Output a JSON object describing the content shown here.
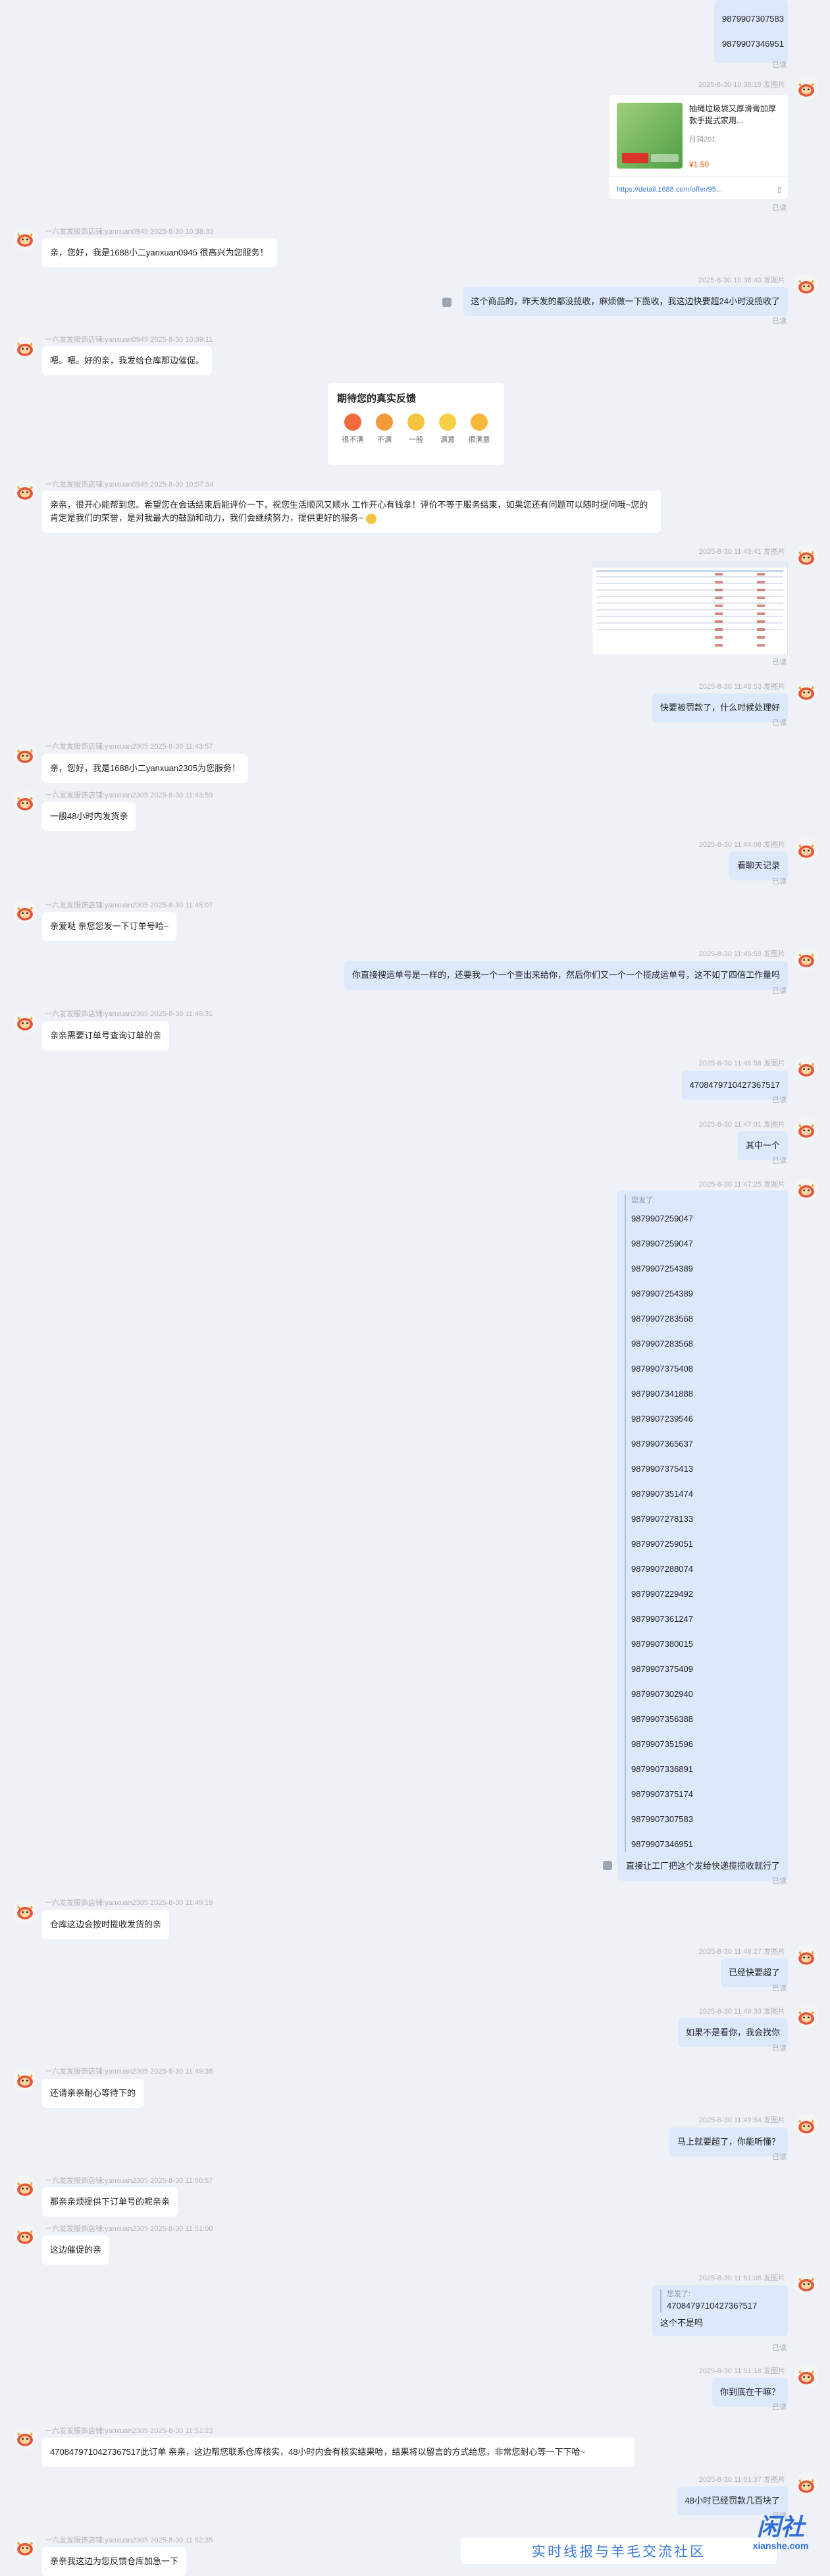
{
  "numbers_top": [
    "9879907307583",
    "9879907346951"
  ],
  "status_read": "已读",
  "m_product": {
    "meta": "2025-8-30 10:38:19   发图片",
    "title": "抽绳垃圾袋又厚滑膏加厚款手提式家用...",
    "shop": "月销201",
    "price": "¥1.50",
    "url": "https://detail.1688.com/offer/95..."
  },
  "m1": {
    "meta": "一六发发服饰店铺:yanxuan0945   2025-8-30 10:38:33",
    "text": "亲，您好，我是1688小二yanxuan0945  很高兴为您服务！"
  },
  "m2": {
    "meta": "2025-8-30 10:38:40   发图片",
    "text": "这个商品的，昨天发的都没揽收，麻烦做一下揽收，我这边快要超24小时没揽收了"
  },
  "m3": {
    "meta": "一六发发服饰店铺:yanxuan0945   2025-8-30 10:39:11",
    "text": "嗯。嗯。好的亲，我发给仓库那边催促。"
  },
  "survey": {
    "title": "期待您的真实反馈",
    "options": [
      "很不满",
      "不满",
      "一般",
      "满意",
      "很满意"
    ]
  },
  "m4": {
    "meta": "一六发发服饰店铺:yanxuan0945   2025-8-30 10:57:34",
    "text": "亲亲，很开心能帮到您。希望您在会话结束后能评价一下，祝您生活顺风又顺水  工作开心有钱拿！评价不等于服务结束，如果您还有问题可以随时提问哦~您的肯定是我们的荣誉，是对我最大的鼓励和动力，我们会继续努力，提供更好的服务~"
  },
  "m5": {
    "meta": "2025-8-30 11:43:41   发图片"
  },
  "m6": {
    "meta": "2025-8-30 11:43:53   发图片",
    "text": "快要被罚款了，什么时候处理好"
  },
  "m7": {
    "meta": "一六发发服饰店铺:yanxuan2305   2025-8-30 11:43:57",
    "text": "亲，您好，我是1688小二yanxuan2305为您服务！"
  },
  "m8": {
    "meta": "一六发发服饰店铺:yanxuan2305   2025-8-30 11:43:59",
    "text": "一般48小时内发货亲"
  },
  "m9": {
    "meta": "2025-8-30 11:44:08   发图片",
    "text": "看聊天记录"
  },
  "m10": {
    "meta": "一六发发服饰店铺:yanxuan2305   2025-8-30 11:45:07",
    "text": "亲爱哒 亲您您发一下订单号哈~"
  },
  "m11": {
    "meta": "2025-8-30 11:45:59   发图片",
    "text": "你直接搜运单号是一样的，还要我一个一个查出来给你，然后你们又一个一个揽成运单号，这不如了四倍工作量吗"
  },
  "m12": {
    "meta": "一六发发服饰店铺:yanxuan2305   2025-8-30 11:46:31",
    "text": "亲亲需要订单号查询订单的亲"
  },
  "m13": {
    "meta": "2025-8-30 11:46:58   发图片",
    "text": "4708479710427367517"
  },
  "m14": {
    "meta": "2025-8-30 11:47:01   发图片",
    "text": "其中一个"
  },
  "m15": {
    "meta": "2025-8-30 11:47:25   发图片",
    "quote_label": "您发了:",
    "numbers": [
      "9879907259047",
      "9879907259047",
      "9879907254389",
      "9879907254389",
      "9879907283568",
      "9879907283568",
      "9879907375408",
      "9879907341888",
      "9879907239546",
      "9879907365637",
      "9879907375413",
      "9879907351474",
      "9879907278133",
      "9879907259051",
      "9879907288074",
      "9879907229492",
      "9879907361247",
      "9879907380015",
      "9879907375409",
      "9879907302940",
      "9879907356388",
      "9879907351596",
      "9879907336891",
      "9879907375174",
      "9879907307583",
      "9879907346951"
    ],
    "text": "直接让工厂把这个发给快递揽揽收就行了"
  },
  "m16": {
    "meta": "一六发发服饰店铺:yanxuan2305   2025-8-30 11:49:19",
    "text": "仓库这边会按时揽收发货的亲"
  },
  "m17": {
    "meta": "2025-8-30 11:49:27   发图片",
    "text": "已经快要超了"
  },
  "m18": {
    "meta": "2025-8-30 11:49:33   发图片",
    "text": "如果不是看你，我会找你"
  },
  "m19": {
    "meta": "一六发发服饰店铺:yanxuan2305   2025-8-30 11:49:38",
    "text": "还请亲亲耐心等待下的"
  },
  "m20": {
    "meta": "2025-8-30 11:49:54   发图片",
    "text": "马上就要超了，你能听懂？"
  },
  "m21": {
    "meta": "一六发发服饰店铺:yanxuan2305   2025-8-30 11:50:57",
    "text": "那亲亲烦提供下订单号的呢亲亲"
  },
  "m22": {
    "meta": "一六发发服饰店铺:yanxuan2305   2025-8-30 11:51:00",
    "text": "这边催促的亲"
  },
  "m23": {
    "meta": "2025-8-30 11:51:08   发图片",
    "quote_label": "您发了:",
    "quote": "4708479710427367517",
    "text": "这个不是吗"
  },
  "m24": {
    "meta": "2025-8-30 11:51:18   发图片",
    "text": "你到底在干嘛？"
  },
  "m25": {
    "meta": "一六发发服饰店铺:yanxuan2305   2025-8-30 11:51:23",
    "text": "4708479710427367517此订单 亲亲，这边帮您联系仓库核实，48小时内会有核实结果哈，结果将以留言的方式给您，非常您耐心等一下下哈~"
  },
  "m26": {
    "meta": "2025-8-30 11:51:37   发图片",
    "text": "48小时已经罚款几百块了"
  },
  "m27": {
    "meta": "一六发发服饰店铺:yanxuan2305   2025-8-30 11:52:35",
    "text": "亲亲我这边为您反馈仓库加急一下"
  },
  "footer": {
    "text": "实时线报与羊毛交流社区",
    "logo": "闲社",
    "logo_url": "xianshe.com"
  }
}
